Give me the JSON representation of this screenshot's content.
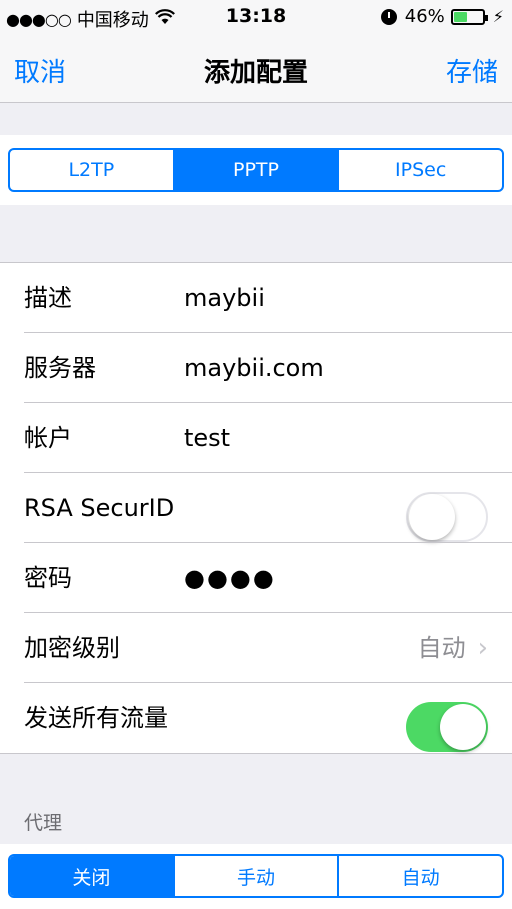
{
  "status": {
    "signal": "●●●○○",
    "carrier": "中国移动",
    "wifi": "◠",
    "time": "13:18",
    "battery": "46%",
    "battery_level": 0.46
  },
  "nav": {
    "cancel": "取消",
    "title": "添加配置",
    "save": "存储"
  },
  "vpn_types": {
    "items": [
      "L2TP",
      "PPTP",
      "IPSec"
    ],
    "selected": "PPTP"
  },
  "fields": {
    "description": {
      "label": "描述",
      "value": "maybii"
    },
    "server": {
      "label": "服务器",
      "value": "maybii.com"
    },
    "account": {
      "label": "帐户",
      "value": "test"
    },
    "rsa": {
      "label": "RSA SecurID",
      "on": false
    },
    "password": {
      "label": "密码",
      "value": "●●●●"
    },
    "encryption": {
      "label": "加密级别",
      "value": "自动"
    },
    "send_all": {
      "label": "发送所有流量",
      "on": true
    }
  },
  "proxy": {
    "header": "代理",
    "items": [
      "关闭",
      "手动",
      "自动"
    ],
    "selected": "关闭"
  },
  "colors": {
    "accent": "#007aff",
    "switch_on": "#4cd964"
  }
}
